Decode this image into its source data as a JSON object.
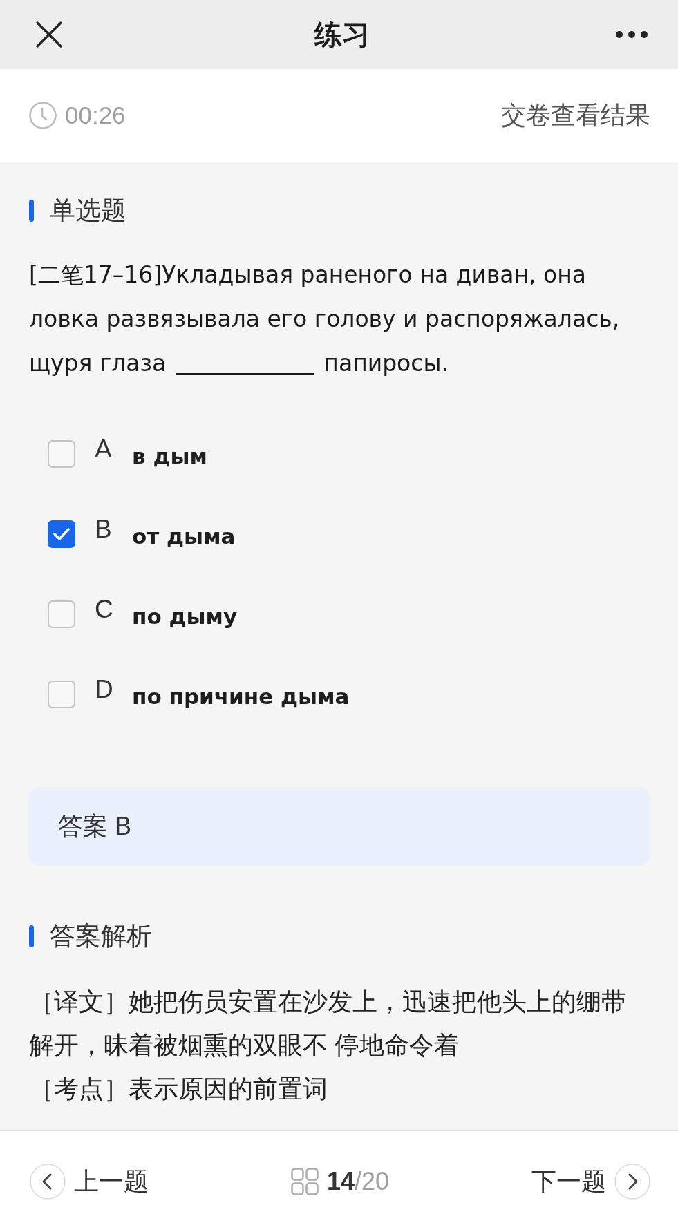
{
  "window": {
    "title": "练习"
  },
  "timer": {
    "time": "00:26",
    "submit_label": "交卷查看结果"
  },
  "question": {
    "type_label": "单选题",
    "parts": [
      {
        "kind": "text",
        "text": "[二笔17–16]Укладывая раненого на диван, она ловка развязывала его голову и распоряжалась, щуря глаза"
      },
      {
        "kind": "blank"
      },
      {
        "kind": "text",
        "text": "папиросы."
      }
    ],
    "options": [
      {
        "letter": "A",
        "text": "в дым",
        "selected": false
      },
      {
        "letter": "B",
        "text": "от дыма",
        "selected": true
      },
      {
        "letter": "C",
        "text": "по дыму",
        "selected": false
      },
      {
        "letter": "D",
        "text": "по причине дыма",
        "selected": false
      }
    ]
  },
  "answer": {
    "text": "答案 B"
  },
  "analysis": {
    "heading": "答案解析",
    "paragraphs": [
      "［译文］她把伤员安置在沙发上，迅速把他头上的绷带解开，昧着被烟熏的双眼不 停地命令着",
      "［考点］表示原因的前置词"
    ]
  },
  "navigation": {
    "prev_label": "上一题",
    "current": "14",
    "total": "/20",
    "next_label": "下一题"
  }
}
